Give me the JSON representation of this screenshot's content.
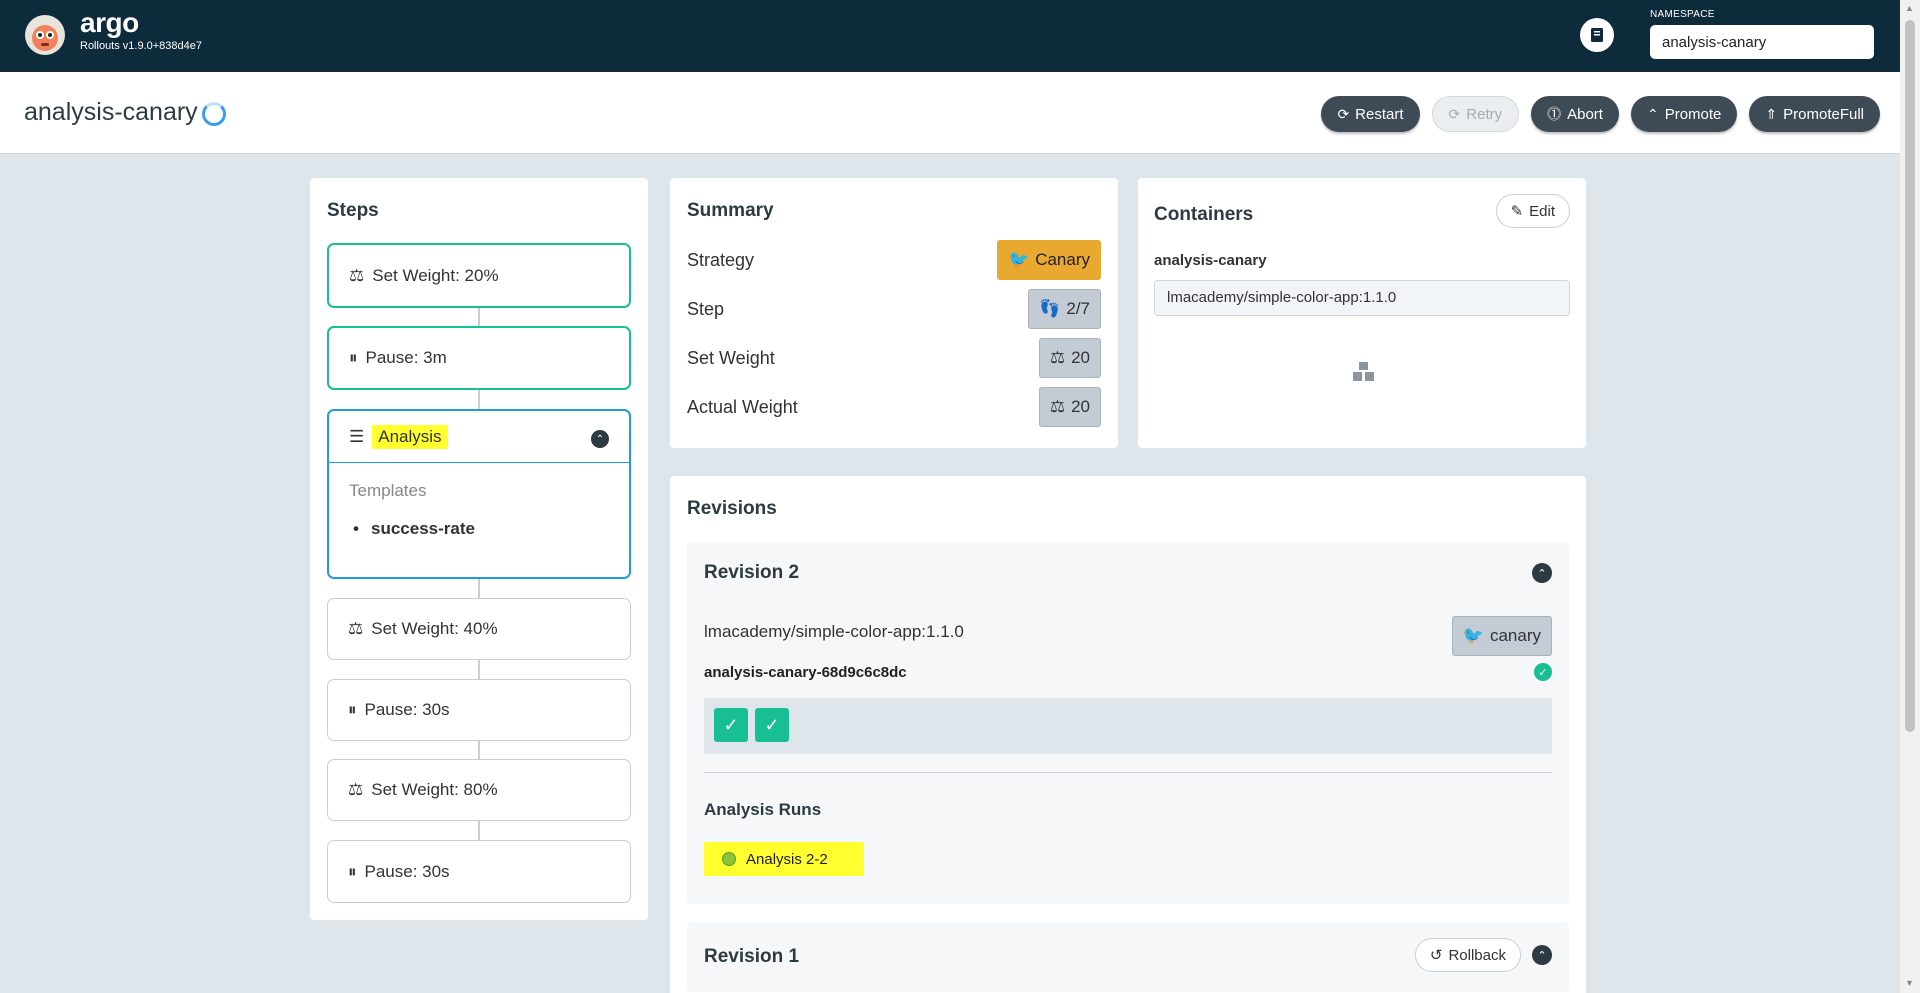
{
  "header": {
    "brand": "argo",
    "version": "Rollouts v1.9.0+838d4e7",
    "namespace_label": "NAMESPACE",
    "namespace_value": "analysis-canary"
  },
  "page": {
    "title": "analysis-canary",
    "actions": [
      "Restart",
      "Retry",
      "Abort",
      "Promote",
      "PromoteFull"
    ]
  },
  "steps": {
    "title": "Steps",
    "items": [
      {
        "label": "Set Weight: 20%",
        "state": "done"
      },
      {
        "label": "Pause: 3m",
        "state": "done"
      },
      {
        "label": "Analysis",
        "state": "active",
        "templates_label": "Templates",
        "templates": [
          "success-rate"
        ]
      },
      {
        "label": "Set Weight: 40%",
        "state": "pending"
      },
      {
        "label": "Pause: 30s",
        "state": "pending"
      },
      {
        "label": "Set Weight: 80%",
        "state": "pending"
      },
      {
        "label": "Pause: 30s",
        "state": "pending"
      }
    ]
  },
  "summary": {
    "title": "Summary",
    "rows": [
      {
        "key": "Strategy",
        "value": "Canary"
      },
      {
        "key": "Step",
        "value": "2/7"
      },
      {
        "key": "Set Weight",
        "value": "20"
      },
      {
        "key": "Actual Weight",
        "value": "20"
      }
    ]
  },
  "containers": {
    "title": "Containers",
    "edit_label": "Edit",
    "name": "analysis-canary",
    "image": "lmacademy/simple-color-app:1.1.0"
  },
  "revisions": {
    "title": "Revisions",
    "items": [
      {
        "title": "Revision 2",
        "image": "lmacademy/simple-color-app:1.1.0",
        "badge": "canary",
        "replicaset": "analysis-canary-68d9c6c8dc",
        "analysis_runs_label": "Analysis Runs",
        "analysis_run": "Analysis 2-2"
      },
      {
        "title": "Revision 1",
        "rollback_label": "Rollback"
      }
    ]
  },
  "colors": {
    "topbar": "#0e2b3c",
    "done": "#18be94",
    "active": "#1e9ed8",
    "canary": "#e9a930",
    "highlight": "#ffff30"
  }
}
